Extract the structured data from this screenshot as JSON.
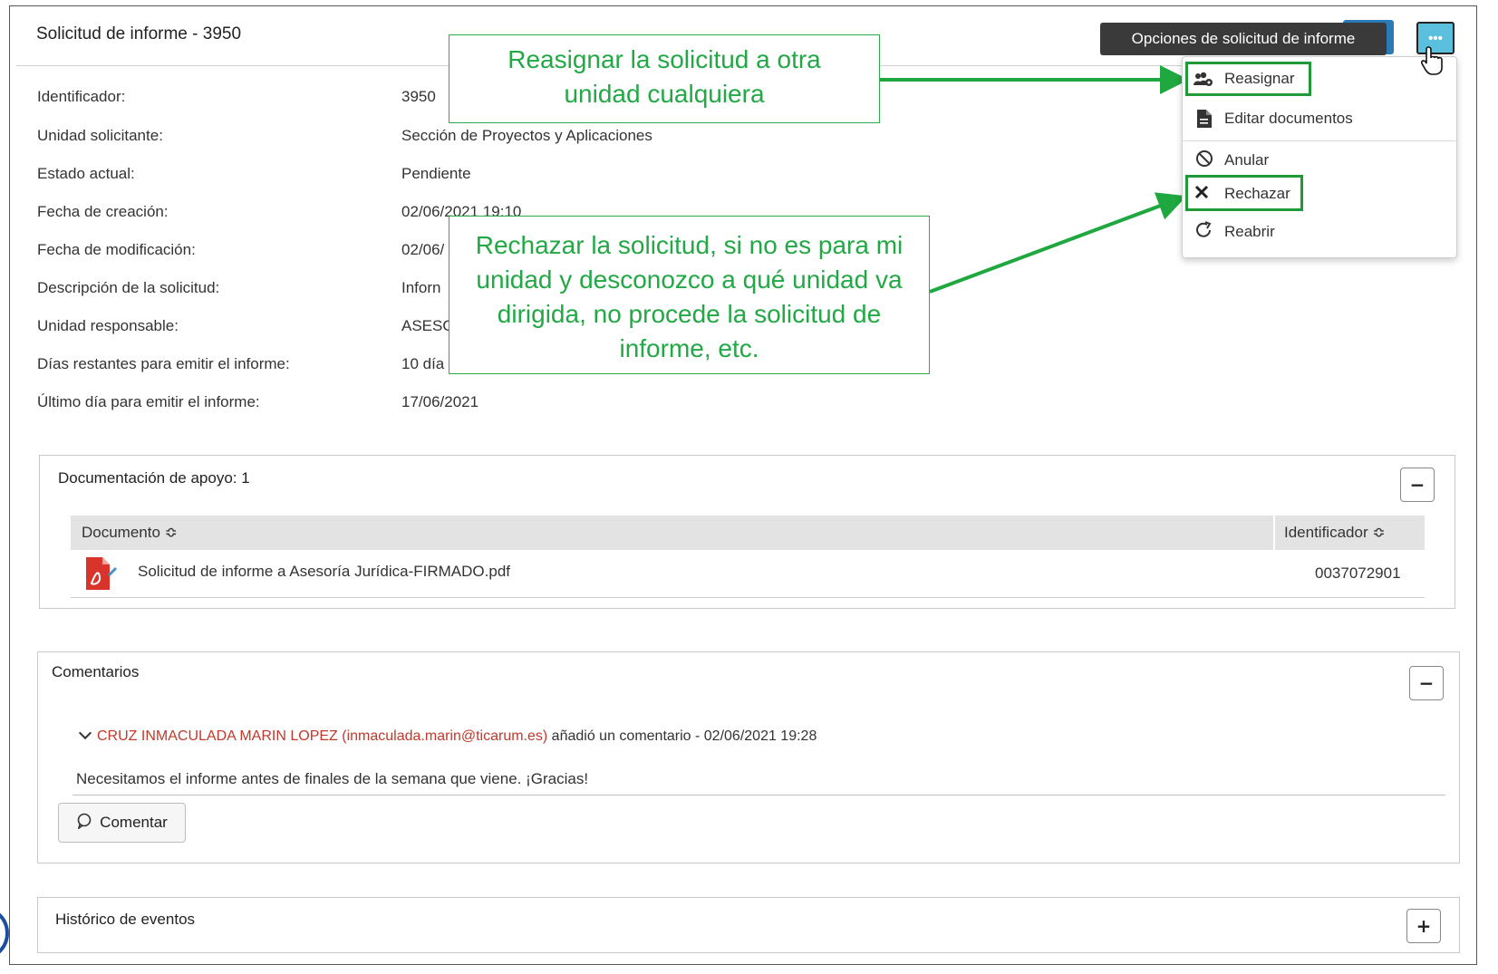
{
  "panel": {
    "title": "Solicitud de informe - 3950"
  },
  "details": [
    {
      "label": "Identificador:",
      "value": "3950"
    },
    {
      "label": "Unidad solicitante:",
      "value": "Sección de Proyectos y Aplicaciones"
    },
    {
      "label": "Estado actual:",
      "value": "Pendiente"
    },
    {
      "label": "Fecha de creación:",
      "value": "02/06/2021 19:10"
    },
    {
      "label": "Fecha de modificación:",
      "value": "02/06/"
    },
    {
      "label": "Descripción de la solicitud:",
      "value": "Inforn"
    },
    {
      "label": "Unidad responsable:",
      "value": "ASESO"
    },
    {
      "label": "Días restantes para emitir el informe:",
      "value": "10 día"
    },
    {
      "label": "Último día para emitir el informe:",
      "value": "17/06/2021"
    }
  ],
  "tooltip": {
    "text": "Opciones de solicitud de informe"
  },
  "more_button": {
    "label": "•••"
  },
  "menu": {
    "items": [
      {
        "label": "Reasignar",
        "icon": "reassign-users-icon"
      },
      {
        "label": "Editar documentos",
        "icon": "document-icon"
      },
      {
        "label": "Anular",
        "icon": "ban-icon"
      },
      {
        "label": "Rechazar",
        "icon": "close-icon"
      },
      {
        "label": "Reabrir",
        "icon": "redo-icon"
      }
    ]
  },
  "annotations": {
    "reassign": "Reasignar la solicitud a otra unidad cualquiera",
    "reject": "Rechazar la solicitud, si no es para mi unidad y desconozco a qué unidad va dirigida, no procede la solicitud de informe, etc."
  },
  "docs": {
    "title": "Documentación de apoyo: 1",
    "toggle": "−",
    "columns": [
      "Documento ≎",
      "Identificador ≎"
    ],
    "rows": [
      {
        "document": "Solicitud de informe a Asesoría Jurídica-FIRMADO.pdf",
        "id": "0037072901"
      }
    ]
  },
  "comments": {
    "title": "Comentarios",
    "toggle": "−",
    "author": "CRUZ INMACULADA MARIN LOPEZ (inmaculada.marin@ticarum.es)",
    "action": " añadió un comentario - 02/06/2021 19:28",
    "text": "Necesitamos el informe antes de finales de la semana que viene. ¡Gracias!",
    "button": "Comentar"
  },
  "history": {
    "title": "Histórico de eventos",
    "toggle": "+"
  },
  "colors": {
    "annotation": "#22a845",
    "highlight": "#1f9a36",
    "author": "#c0392b",
    "more_button": "#5bc0de"
  }
}
